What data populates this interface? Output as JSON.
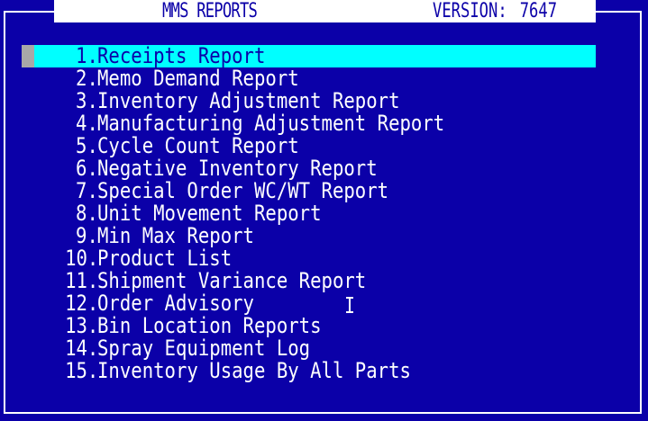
{
  "header": {
    "title": "MMS REPORTS",
    "version_label": "VERSION:",
    "version_number": "7647"
  },
  "menu": {
    "selected_index": 0,
    "items": [
      {
        "num": "1.",
        "label": "Receipts Report"
      },
      {
        "num": "2.",
        "label": "Memo Demand Report"
      },
      {
        "num": "3.",
        "label": "Inventory Adjustment Report"
      },
      {
        "num": "4.",
        "label": "Manufacturing Adjustment Report"
      },
      {
        "num": "5.",
        "label": "Cycle Count Report"
      },
      {
        "num": "6.",
        "label": "Negative Inventory Report"
      },
      {
        "num": "7.",
        "label": "Special Order WC/WT Report"
      },
      {
        "num": "8.",
        "label": "Unit Movement Report"
      },
      {
        "num": "9.",
        "label": "Min Max Report"
      },
      {
        "num": "10.",
        "label": "Product List"
      },
      {
        "num": "11.",
        "label": "Shipment Variance Report"
      },
      {
        "num": "12.",
        "label": "Order Advisory"
      },
      {
        "num": "13.",
        "label": "Bin Location Reports"
      },
      {
        "num": "14.",
        "label": "Spray Equipment Log"
      },
      {
        "num": "15.",
        "label": "Inventory Usage By All Parts"
      }
    ]
  },
  "colors": {
    "background": "#0b00a8",
    "highlight": "#00ffff",
    "text": "#ffffff"
  },
  "cursor_icon": "text-cursor-icon"
}
